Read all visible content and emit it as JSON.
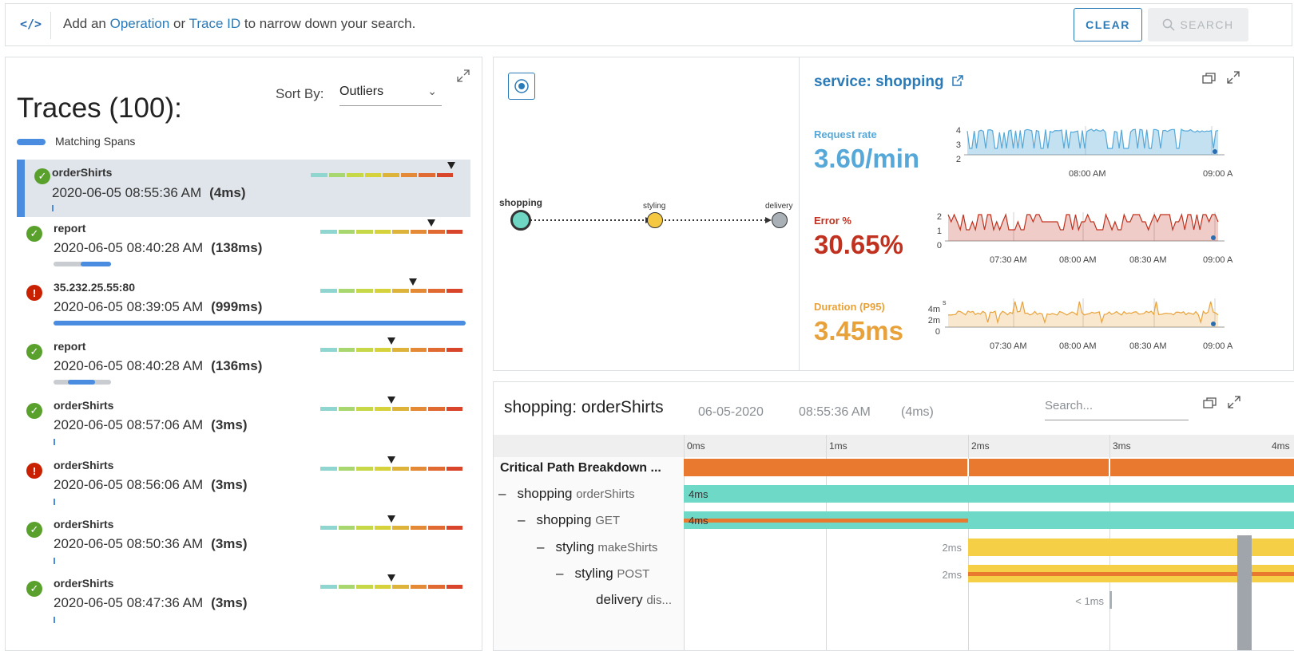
{
  "topbar": {
    "hint_prefix": "Add an",
    "hint_link1": "Operation",
    "hint_mid": "or",
    "hint_link2": "Trace ID",
    "hint_suffix": "to narrow down your search.",
    "clear_label": "CLEAR",
    "search_label": "SEARCH",
    "code_icon": "</>"
  },
  "traces": {
    "title": "Traces (100):",
    "sort_label": "Sort By:",
    "sort_value": "Outliers",
    "legend_label": "Matching Spans",
    "heat_colors": [
      "#8fd6d0",
      "#a8d770",
      "#c6d847",
      "#d5d23c",
      "#deb33a",
      "#e48a36",
      "#e06a32",
      "#d9452b"
    ],
    "items": [
      {
        "status": "ok",
        "name": "orderShirts",
        "time": "2020-06-05 08:55:36 AM",
        "duration": "(4ms)",
        "marker_pos": 0.99,
        "selected": true,
        "span_fraction": 0.004
      },
      {
        "status": "ok",
        "name": "report",
        "time": "2020-06-05 08:40:28 AM",
        "duration": "(138ms)",
        "marker_pos": 0.78,
        "selected": false,
        "span_fraction": 0.14
      },
      {
        "status": "err",
        "name": "35.232.25.55:80",
        "time": "2020-06-05 08:39:05 AM",
        "duration": "(999ms)",
        "marker_pos": 0.65,
        "selected": false,
        "span_fraction": 1.0
      },
      {
        "status": "ok",
        "name": "report",
        "time": "2020-06-05 08:40:28 AM",
        "duration": "(136ms)",
        "marker_pos": 0.5,
        "selected": false,
        "span_fraction": 0.14
      },
      {
        "status": "ok",
        "name": "orderShirts",
        "time": "2020-06-05 08:57:06 AM",
        "duration": "(3ms)",
        "marker_pos": 0.5,
        "selected": false,
        "span_fraction": 0.003
      },
      {
        "status": "err",
        "name": "orderShirts",
        "time": "2020-06-05 08:56:06 AM",
        "duration": "(3ms)",
        "marker_pos": 0.5,
        "selected": false,
        "span_fraction": 0.003
      },
      {
        "status": "ok",
        "name": "orderShirts",
        "time": "2020-06-05 08:50:36 AM",
        "duration": "(3ms)",
        "marker_pos": 0.5,
        "selected": false,
        "span_fraction": 0.003
      },
      {
        "status": "ok",
        "name": "orderShirts",
        "time": "2020-06-05 08:47:36 AM",
        "duration": "(3ms)",
        "marker_pos": 0.5,
        "selected": false,
        "span_fraction": 0.003
      }
    ]
  },
  "service_map": {
    "nodes": [
      {
        "name": "shopping",
        "color": "#6fd6c3"
      },
      {
        "name": "styling",
        "color": "#f5c842"
      },
      {
        "name": "delivery",
        "color": "#a9b0b6"
      }
    ]
  },
  "service": {
    "title": "service: shopping",
    "metrics": [
      {
        "label": "Request rate",
        "value": "3.60/min",
        "color": "#56a8d8",
        "yticks": [
          "4",
          "3",
          "2"
        ],
        "xticks": [
          "08:00 AM",
          "09:00 A"
        ]
      },
      {
        "label": "Error %",
        "value": "30.65%",
        "color": "#c0321f",
        "yticks": [
          "2",
          "1",
          "0"
        ],
        "xticks": [
          "07:30 AM",
          "08:00 AM",
          "08:30 AM",
          "09:00 A"
        ]
      },
      {
        "label": "Duration (P95)",
        "value": "3.45ms",
        "color": "#e8a23b",
        "yticks": [
          "4m",
          "2m",
          "0"
        ],
        "xticks": [
          "07:30 AM",
          "08:00 AM",
          "08:30 AM",
          "09:00 A"
        ],
        "yunit": "s"
      }
    ]
  },
  "detail": {
    "title": "shopping: orderShirts",
    "date": "06-05-2020",
    "time": "08:55:36 AM",
    "duration": "(4ms)",
    "search_placeholder": "Search...",
    "ticks": [
      "0ms",
      "1ms",
      "2ms",
      "3ms",
      "4ms"
    ],
    "critical_label": "Critical Path Breakdown ...",
    "rows": [
      {
        "service": "shopping",
        "op": "orderShirts",
        "dash": "–",
        "bar_label": "4ms"
      },
      {
        "service": "shopping",
        "op": "GET",
        "dash": "–",
        "bar_label": "4ms"
      },
      {
        "service": "styling",
        "op": "makeShirts",
        "dash": "–",
        "bar_label": "2ms"
      },
      {
        "service": "styling",
        "op": "POST",
        "dash": "–",
        "bar_label": "2ms"
      },
      {
        "service": "delivery",
        "op": "dis...",
        "dash": "",
        "bar_label": "< 1ms"
      }
    ]
  }
}
